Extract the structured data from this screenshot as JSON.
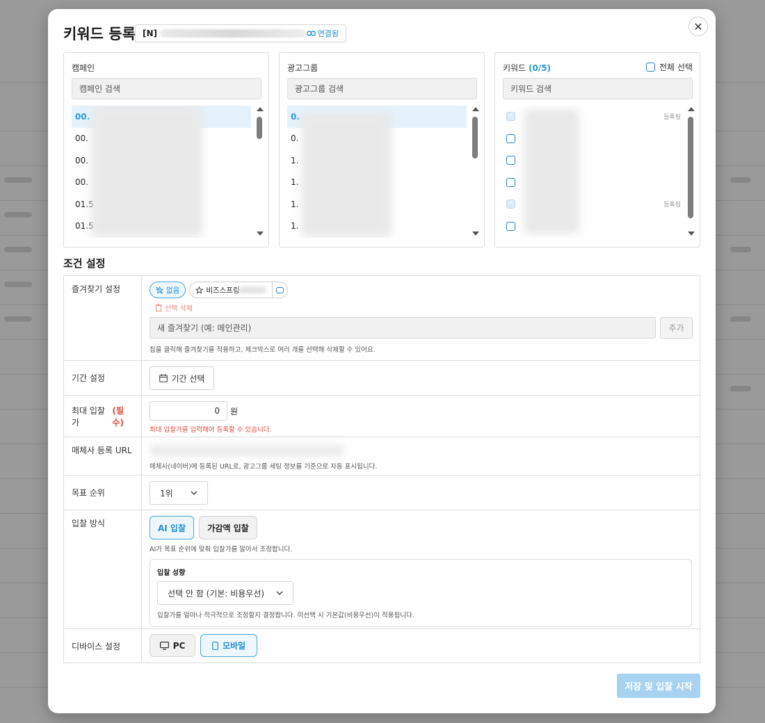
{
  "modal": {
    "title": "키워드 등록",
    "account_name": "[N]",
    "account_link": "연결됨"
  },
  "campaign": {
    "title": "캠페인",
    "search_placeholder": "캠페인 검색",
    "items": [
      "00.",
      "00.",
      "00.",
      "00.",
      "01.5",
      "01.5"
    ]
  },
  "adgroup": {
    "title": "광고그룹",
    "search_placeholder": "광고그룹 검색",
    "items": [
      "0.",
      "0.",
      "1.",
      "1.",
      "1.",
      "1."
    ]
  },
  "keyword": {
    "title": "키워드",
    "count": "(0/5)",
    "select_all": "전체 선택",
    "search_placeholder": "키워드 검색",
    "registered_label": "등록됨",
    "rows": [
      {
        "checked": true,
        "registered": true
      },
      {
        "checked": false,
        "registered": false
      },
      {
        "checked": false,
        "registered": false
      },
      {
        "checked": false,
        "registered": false
      },
      {
        "checked": true,
        "registered": true
      },
      {
        "checked": false,
        "registered": false
      }
    ]
  },
  "conditions": {
    "section_title": "조건 설정",
    "favorites": {
      "label": "즐겨찾기 설정",
      "chip_none": "없음",
      "chip_saved": "비즈스프링",
      "delete_selected": "선택 삭제",
      "new_placeholder": "새 즐겨찾기 (예: 메인관리)",
      "add_button": "추가",
      "help": "칩을 클릭해 즐겨찾기를 적용하고, 체크박스로 여러 개를 선택해 삭제할 수 있어요."
    },
    "period": {
      "label": "기간 설정",
      "button": "기간 선택"
    },
    "max_bid": {
      "label": "최대 입찰가",
      "required": "(필수)",
      "value": "0",
      "unit": "원",
      "error": "최대 입찰가를 입력해야 등록할 수 있습니다."
    },
    "url": {
      "label": "매체사 등록 URL",
      "help": "매체사(네이버)에 등록된 URL로, 광고그룹 세팅 정보를 기준으로 자동 표시됩니다."
    },
    "target_rank": {
      "label": "목표 순위",
      "value": "1위"
    },
    "bid_method": {
      "label": "입찰 방식",
      "ai_button": "AI 입찰",
      "step_button": "가감액 입찰",
      "help": "AI가 목표 순위에 맞춰 입찰가를 알아서 조정합니다.",
      "tendency_title": "입찰 성향",
      "tendency_value": "선택 안 함 (기본: 비용우선)",
      "tendency_help": "입찰가를 얼마나 적극적으로 조정할지 결정합니다. 미선택 시 기본값(비용우선)이 적용됩니다."
    },
    "device": {
      "label": "디바이스 설정",
      "pc": "PC",
      "mobile": "모바일"
    }
  },
  "footer": {
    "save_button": "저장 및 입찰 시작"
  },
  "colors": {
    "accent": "#1f8fd0",
    "error": "#e24b3b",
    "save_disabled": "#a7d3f0"
  }
}
